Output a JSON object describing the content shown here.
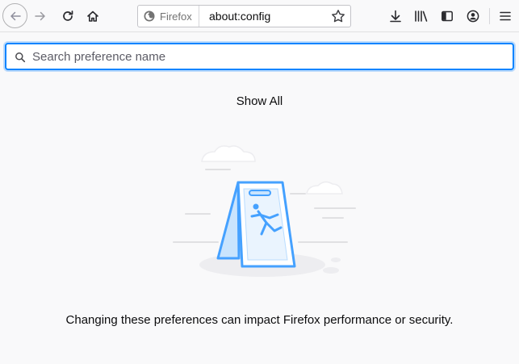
{
  "toolbar": {
    "back_icon": "back-arrow-icon",
    "forward_icon": "forward-arrow-icon",
    "reload_icon": "reload-icon",
    "home_icon": "home-icon",
    "identity_label": "Firefox",
    "url": "about:config",
    "bookmark_icon": "star-icon",
    "downloads_icon": "download-icon",
    "library_icon": "library-icon",
    "sidebar_icon": "sidebar-icon",
    "account_icon": "account-icon",
    "menu_icon": "hamburger-menu-icon"
  },
  "search": {
    "placeholder": "Search preference name",
    "value": ""
  },
  "show_all_label": "Show All",
  "warning_text": "Changing these preferences can impact Firefox performance or security.",
  "colors": {
    "accent": "#0a84ff",
    "background": "#f9f9fa",
    "illustration_blue": "#45a1ff"
  }
}
